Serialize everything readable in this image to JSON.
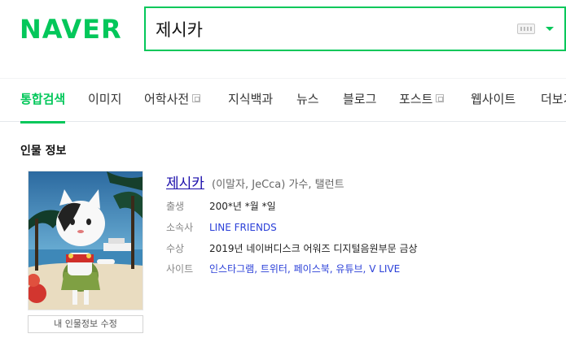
{
  "header": {
    "logo": "NAVER",
    "search": {
      "value": "제시카",
      "placeholder": ""
    },
    "colors": {
      "brand": "#03c75a"
    }
  },
  "tabs": [
    {
      "label": "통합검색",
      "active": true
    },
    {
      "label": "이미지"
    },
    {
      "label": "어학사전",
      "external": true
    },
    {
      "label": "지식백과"
    },
    {
      "label": "뉴스"
    },
    {
      "label": "블로그"
    },
    {
      "label": "포스트",
      "external": true
    },
    {
      "label": "웹사이트"
    },
    {
      "label": "더보기"
    }
  ],
  "person": {
    "section_title": "인물 정보",
    "name": "제시카",
    "name_sub": "(이말자, JeCca) 가수, 탤런트",
    "photo_button": "내 인물정보 수정",
    "rows": {
      "birth": {
        "key": "출생",
        "value": "200*년 *월 *일"
      },
      "agency": {
        "key": "소속사",
        "value": "LINE FRIENDS"
      },
      "award": {
        "key": "수상",
        "value": "2019년 네이버디스크 어워즈 디지털음원부문 금상"
      },
      "site": {
        "key": "사이트",
        "links": [
          "인스타그램",
          "트위터",
          "페이스북",
          "유튜브",
          "V LIVE"
        ]
      }
    }
  }
}
